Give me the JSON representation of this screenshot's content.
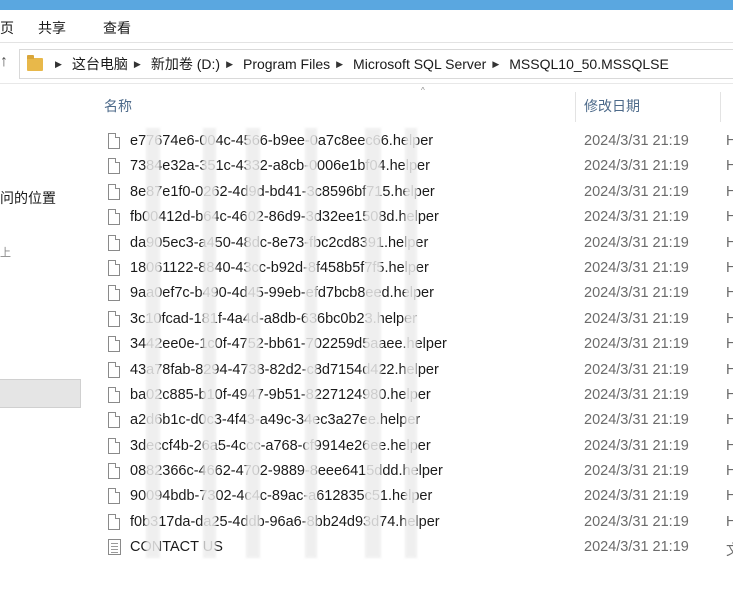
{
  "ribbon": {
    "tab_view_cut": "页",
    "tab_share": "共享",
    "tab_view": "查看"
  },
  "address": {
    "crumbs": [
      "这台电脑",
      "新加卷 (D:)",
      "Program Files",
      "Microsoft SQL Server",
      "MSSQL10_50.MSSQLSE"
    ]
  },
  "nav": {
    "item_location": "问的位置",
    "item_bracket": "上"
  },
  "columns": {
    "name": "名称",
    "date": "修改日期"
  },
  "files": [
    {
      "name": "e77674e6-004c-4566-b9ee-0a7c8eec66.helper",
      "date": "2024/3/31 21:19",
      "tail": "H",
      "type": "file"
    },
    {
      "name": "7384e32a-351c-4332-a8cb-0006e1bf04.helper",
      "date": "2024/3/31 21:19",
      "tail": "H",
      "type": "file"
    },
    {
      "name": "8e87e1f0-0262-4d9d-bd41-3c8596bf715.helper",
      "date": "2024/3/31 21:19",
      "tail": "H",
      "type": "file"
    },
    {
      "name": "fb00412d-b64c-4602-86d9-3d32ee1508d.helper",
      "date": "2024/3/31 21:19",
      "tail": "H",
      "type": "file"
    },
    {
      "name": "da905ec3-a450-48dc-8e73-fbc2cd8391.helper",
      "date": "2024/3/31 21:19",
      "tail": "H",
      "type": "file"
    },
    {
      "name": "18061122-8840-43cc-b92d-8f458b5f7f5.helper",
      "date": "2024/3/31 21:19",
      "tail": "H",
      "type": "file"
    },
    {
      "name": "9aa0ef7c-b490-4d45-99eb-efd7bcb8eed.helper",
      "date": "2024/3/31 21:19",
      "tail": "H",
      "type": "file"
    },
    {
      "name": "3c10fcad-181f-4a4d-a8db-636bc0b23.helper",
      "date": "2024/3/31 21:19",
      "tail": "H",
      "type": "file"
    },
    {
      "name": "3442ee0e-1c0f-4752-bb61-702259d5aaee.helper",
      "date": "2024/3/31 21:19",
      "tail": "H",
      "type": "file"
    },
    {
      "name": "43a78fab-8294-4738-82d2-c8d7154d422.helper",
      "date": "2024/3/31 21:19",
      "tail": "H",
      "type": "file"
    },
    {
      "name": "ba02c885-b10f-4947-9b51-8227124980.helper",
      "date": "2024/3/31 21:19",
      "tail": "H",
      "type": "file"
    },
    {
      "name": "a2d6b1c-d0c3-4f43-a49c-34ec3a27ee.helper",
      "date": "2024/3/31 21:19",
      "tail": "H",
      "type": "file"
    },
    {
      "name": "3deccf4b-26a5-4ccc-a768-cf9914e26ee.helper",
      "date": "2024/3/31 21:19",
      "tail": "H",
      "type": "file"
    },
    {
      "name": "0882366c-4662-4702-9889-8eee6415ddd.helper",
      "date": "2024/3/31 21:19",
      "tail": "H",
      "type": "file"
    },
    {
      "name": "90094bdb-7302-4c4c-89ac-a612835c51.helper",
      "date": "2024/3/31 21:19",
      "tail": "H",
      "type": "file"
    },
    {
      "name": "f0b317da-da25-4ddb-96a6-8bb24d93d74.helper",
      "date": "2024/3/31 21:19",
      "tail": "H",
      "type": "file"
    },
    {
      "name": "CONTACT US",
      "date": "2024/3/31 21:19",
      "tail": "文",
      "type": "doc"
    }
  ],
  "colors": {
    "accent_strip": "#5aa7e0",
    "header_text": "#4d6a8a",
    "date_text": "#6b6b6b"
  }
}
